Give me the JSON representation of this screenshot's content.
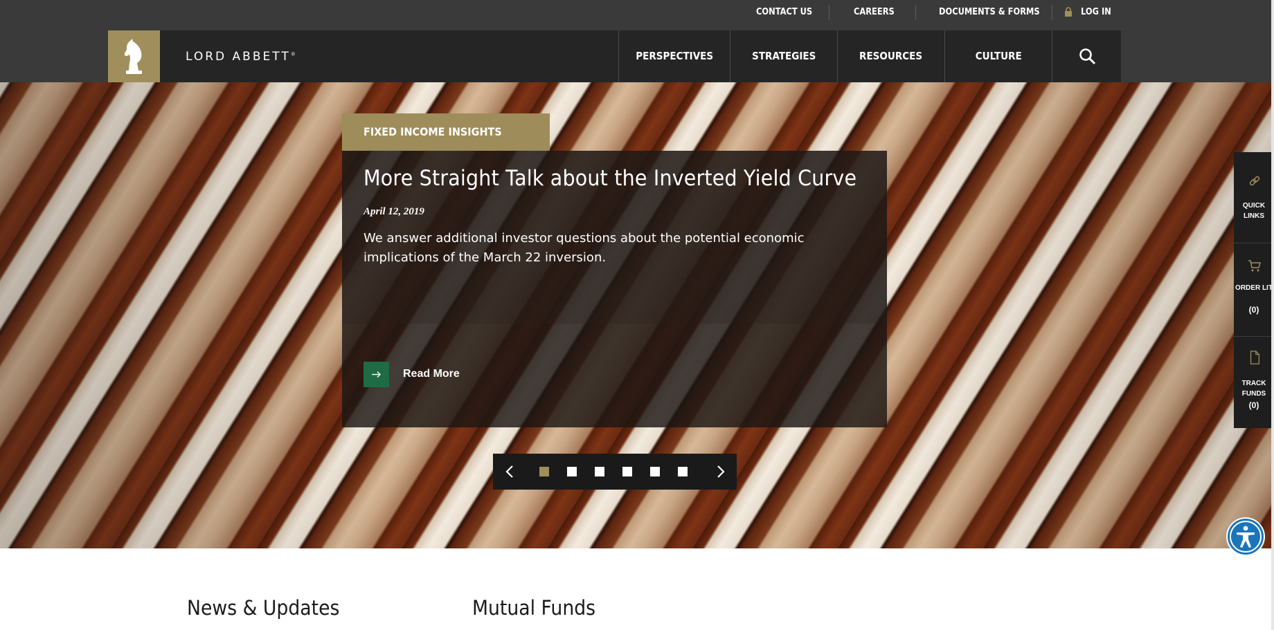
{
  "utility_nav": {
    "contact": "CONTACT US",
    "careers": "CAREERS",
    "documents": "DOCUMENTS & FORMS",
    "login": "LOG IN"
  },
  "brand": {
    "name": "LORD ABBETT",
    "trademark": "®"
  },
  "main_nav": {
    "items": [
      {
        "label": "PERSPECTIVES"
      },
      {
        "label": "STRATEGIES"
      },
      {
        "label": "RESOURCES"
      },
      {
        "label": "CULTURE"
      }
    ],
    "search_icon": "search-icon"
  },
  "hero": {
    "category": "FIXED INCOME INSIGHTS",
    "title": "More Straight Talk about the Inverted Yield Curve",
    "date": "April 12, 2019",
    "description": "We answer additional investor questions about the potential economic implications of the March 22 inversion.",
    "cta": "Read More",
    "slides_total": 6,
    "active_slide": 1
  },
  "side_panel": {
    "quick_links": "QUICK LINKS",
    "order_lit": "ORDER LIT",
    "order_lit_count": "(0)",
    "track_funds": "TRACK FUNDS",
    "track_funds_count": "(0)"
  },
  "sections": {
    "news": "News & Updates",
    "funds": "Mutual Funds"
  },
  "colors": {
    "gold": "#a08f5c",
    "nav_dark": "#252525",
    "cta_green": "#1f6b45",
    "a11y_blue": "#1b75bb"
  }
}
